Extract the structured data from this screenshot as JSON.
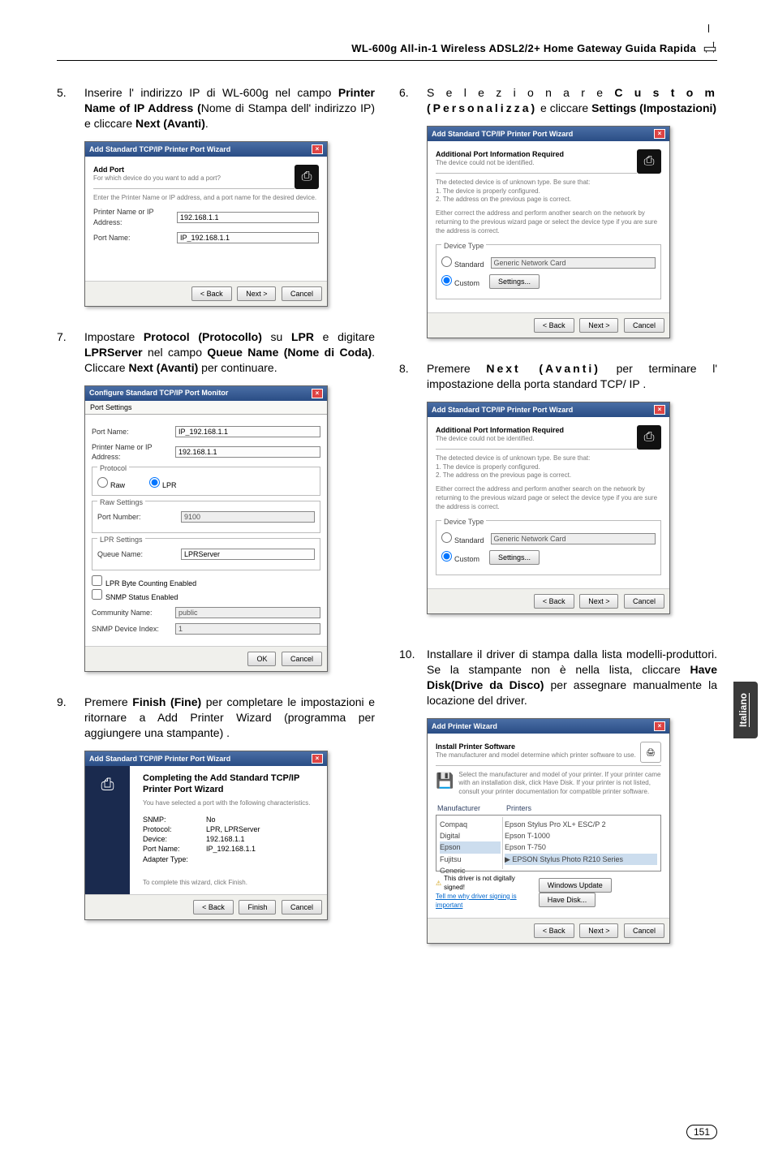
{
  "header": {
    "title": "WL-600g All-in-1 Wireless ADSL2/2+ Home Gateway Guida Rapida"
  },
  "page_number": "151",
  "side_tab": "Italiano",
  "steps": {
    "s5_num": "5.",
    "s5_text_a": "Inserire l' indirizzo IP di WL-600g nel campo ",
    "s5_b1": "Printer Name of IP Address (",
    "s5_text_b": "Nome di Stampa dell' indirizzo IP) e cliccare ",
    "s5_b2": "Next (Avanti)",
    "s5_text_c": ".",
    "s6_num": "6.",
    "s6_text_a": "S e l e z i o n a r e ",
    "s6_b1": "C u s t o m (Personalizza)",
    "s6_text_b": " e cliccare ",
    "s6_b2": "Settings (Impostazioni)",
    "s7_num": "7.",
    "s7_text_a": "Impostare ",
    "s7_b1": "Protocol (Protocollo)",
    "s7_text_b": " su ",
    "s7_b2": "LPR",
    "s7_text_c": " e digitare ",
    "s7_b3": "LPRServer",
    "s7_text_d": " nel campo ",
    "s7_b4": "Queue Name (Nome di Coda)",
    "s7_text_e": ". Cliccare ",
    "s7_b5": "Next (Avanti)",
    "s7_text_f": " per continuare.",
    "s8_num": "8.",
    "s8_text_a": "Premere ",
    "s8_b1": "Next (Avanti)",
    "s8_text_b": " per terminare l' impostazione della porta standard TCP/ IP .",
    "s9_num": "9.",
    "s9_text_a": "Premere ",
    "s9_b1": "Finish (Fine)",
    "s9_text_b": " per completare le impostazioni e ritornare a Add Printer Wizard (programma per aggiungere una stampante) .",
    "s10_num": "10.",
    "s10_text_a": "Installare il driver di stampa dalla lista modelli-produttori. Se la stampante non è nella lista, cliccare ",
    "s10_b1": "Have Disk(Drive da Disco)",
    "s10_text_b": " per assegnare manualmente la locazione del driver."
  },
  "dlg1": {
    "title": "Add Standard TCP/IP Printer Port Wizard",
    "heading": "Add Port",
    "sub": "For which device do you want to add a port?",
    "desc": "Enter the Printer Name or IP address, and a port name for the desired device.",
    "f1_label": "Printer Name or IP Address:",
    "f1_value": "192.168.1.1",
    "f2_label": "Port Name:",
    "f2_value": "IP_192.168.1.1",
    "back": "< Back",
    "next": "Next >",
    "cancel": "Cancel"
  },
  "dlg2": {
    "title": "Add Standard TCP/IP Printer Port Wizard",
    "heading": "Additional Port Information Required",
    "sub": "The device could not be identified.",
    "para1": "The detected device is of unknown type. Be sure that:\n1. The device is properly configured.\n2. The address on the previous page is correct.",
    "para2": "Either correct the address and perform another search on the network by returning to the previous wizard page or select the device type if you are sure the address is correct.",
    "group": "Device Type",
    "opt1": "Standard",
    "opt1_sel": "Generic Network Card",
    "opt2": "Custom",
    "settings": "Settings...",
    "back": "< Back",
    "next": "Next >",
    "cancel": "Cancel"
  },
  "dlg3": {
    "title": "Configure Standard TCP/IP Port Monitor",
    "tab": "Port Settings",
    "f_portname": "Port Name:",
    "v_portname": "IP_192.168.1.1",
    "f_printer": "Printer Name or IP Address:",
    "v_printer": "192.168.1.1",
    "g_protocol": "Protocol",
    "opt_raw": "Raw",
    "opt_lpr": "LPR",
    "g_raw": "Raw Settings",
    "f_rawport": "Port Number:",
    "v_rawport": "9100",
    "g_lpr": "LPR Settings",
    "f_queue": "Queue Name:",
    "v_queue": "LPRServer",
    "chk_byte": "LPR Byte Counting Enabled",
    "chk_snmp": "SNMP Status Enabled",
    "f_comm": "Community Name:",
    "v_comm": "public",
    "f_index": "SNMP Device Index:",
    "v_index": "1",
    "ok": "OK",
    "cancel": "Cancel"
  },
  "dlg4": {
    "title": "Add Standard TCP/IP Printer Port Wizard",
    "heading": "Completing the Add Standard TCP/IP Printer Port Wizard",
    "sub": "You have selected a port with the following characteristics.",
    "rows": [
      {
        "k": "SNMP:",
        "v": "No"
      },
      {
        "k": "Protocol:",
        "v": "LPR, LPRServer"
      },
      {
        "k": "Device:",
        "v": "192.168.1.1"
      },
      {
        "k": "Port Name:",
        "v": "IP_192.168.1.1"
      },
      {
        "k": "Adapter Type:",
        "v": ""
      }
    ],
    "closing": "To complete this wizard, click Finish.",
    "back": "< Back",
    "finish": "Finish",
    "cancel": "Cancel"
  },
  "dlg5": {
    "title": "Add Printer Wizard",
    "heading": "Install Printer Software",
    "sub": "The manufacturer and model determine which printer software to use.",
    "desc": "Select the manufacturer and model of your printer. If your printer came with an installation disk, click Have Disk. If your printer is not listed, consult your printer documentation for compatible printer software.",
    "col1": "Manufacturer",
    "col2": "Printers",
    "mfrs": [
      "Compaq",
      "Digital",
      "Epson",
      "Fujitsu",
      "Generic"
    ],
    "models": [
      "Epson Stylus Pro XL+ ESC/P 2",
      "Epson T-1000",
      "Epson T-750",
      "EPSON Stylus Photo R210 Series"
    ],
    "signed": "This driver is not digitally signed!",
    "tell": "Tell me why driver signing is important",
    "wu": "Windows Update",
    "hd": "Have Disk...",
    "back": "< Back",
    "next": "Next >",
    "cancel": "Cancel"
  }
}
